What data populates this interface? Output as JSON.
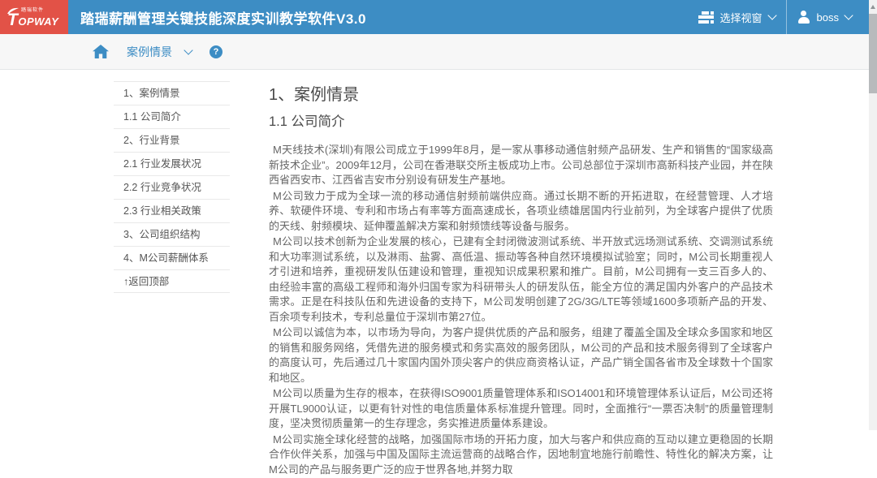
{
  "header": {
    "brand": {
      "name": "TOPWAY",
      "subtext": "踏瑞软件"
    },
    "title": "踏瑞薪酬管理关键技能深度实训教学软件V3.0",
    "window_selector_label": "选择视窗",
    "username": "boss"
  },
  "toolbar": {
    "tab_label": "案例情景",
    "help_glyph": "?"
  },
  "sidebar": {
    "items": [
      "1、案例情景",
      "1.1 公司简介",
      "2、行业背景",
      "2.1 行业发展状况",
      "2.2 行业竞争状况",
      "2.3 行业相关政策",
      "3、公司组织结构",
      "4、M公司薪酬体系",
      "↑返回顶部"
    ]
  },
  "content": {
    "heading": "1、案例情景",
    "subheading": "1.1 公司简介",
    "paragraphs": [
      "M天线技术(深圳)有限公司成立于1999年8月，是一家从事移动通信射频产品研发、生产和销售的“国家级高新技术企业”。2009年12月，公司在香港联交所主板成功上市。公司总部位于深圳市高新科技产业园，并在陕西省西安市、江西省吉安市分别设有研发生产基地。",
      "M公司致力于成为全球一流的移动通信射频前端供应商。通过长期不断的开拓进取，在经营管理、人才培养、软硬件环境、专利和市场占有率等方面高速成长，各项业绩雄居国内行业前列，为全球客户提供了优质的天线、射频模块、延伸覆盖解决方案和射频馈线等设备与服务。",
      "M公司以技术创新为企业发展的核心，已建有全封闭微波测试系统、半开放式远场测试系统、交调测试系统和大功率测试系统，以及淋雨、盐雾、高低温、振动等各种自然环境模拟试验室；同时，M公司长期重视人才引进和培养，重视研发队伍建设和管理，重视知识成果积累和推广。目前，M公司拥有一支三百多人的、由经验丰富的高级工程师和海外归国专家为科研带头人的研发队伍，能全方位的满足国内外客户的产品技术需求。正是在科技队伍和先进设备的支持下，M公司发明创建了2G/3G/LTE等领域1600多项新产品的开发、百余项专利技术，专利总量位于深圳市第27位。",
      "M公司以诚信为本，以市场为导向，为客户提供优质的产品和服务，组建了覆盖全国及全球众多国家和地区的销售和服务网络，凭借先进的服务模式和务实高效的服务团队，M公司的产品和技术服务得到了全球客户的高度认可，先后通过几十家国内国外顶尖客户的供应商资格认证，产品广销全国各省市及全球数十个国家和地区。",
      "M公司以质量为生存的根本，在获得ISO9001质量管理体系和ISO14001和环境管理体系认证后，M公司还将开展TL9000认证，以更有针对性的电信质量体系标准提升管理。同时，全面推行“一票否决制”的质量管理制度，坚决贯彻质量第一的生存理念，务实推进质量体系建设。",
      "M公司实施全球化经营的战略，加强国际市场的开拓力度，加大与客户和供应商的互动以建立更稳固的长期合作伙伴关系，加强与中国及国际主流运营商的战略合作，因地制宜地施行前瞻性、特性化的解决方案，让M公司的产品与服务更广泛的应于世界各地,并努力取"
    ]
  },
  "icons": {
    "logo_flame": "flame-swoosh-icon",
    "window_selector": "windows-list-icon",
    "user": "user-icon",
    "chevron": "chevron-down-icon",
    "home": "home-icon",
    "help": "question-mark-icon",
    "scroll_up": "scroll-up-arrow-icon"
  },
  "colors": {
    "header_blue": "#3d8dc4",
    "logo_red": "#e25247",
    "toolbar_bg": "#f7f7f7",
    "link_blue": "#3d8dc4",
    "heading_text": "#4a4a4a",
    "body_text": "#666666",
    "sidebar_text": "#555555",
    "border": "#e9e9e9"
  }
}
